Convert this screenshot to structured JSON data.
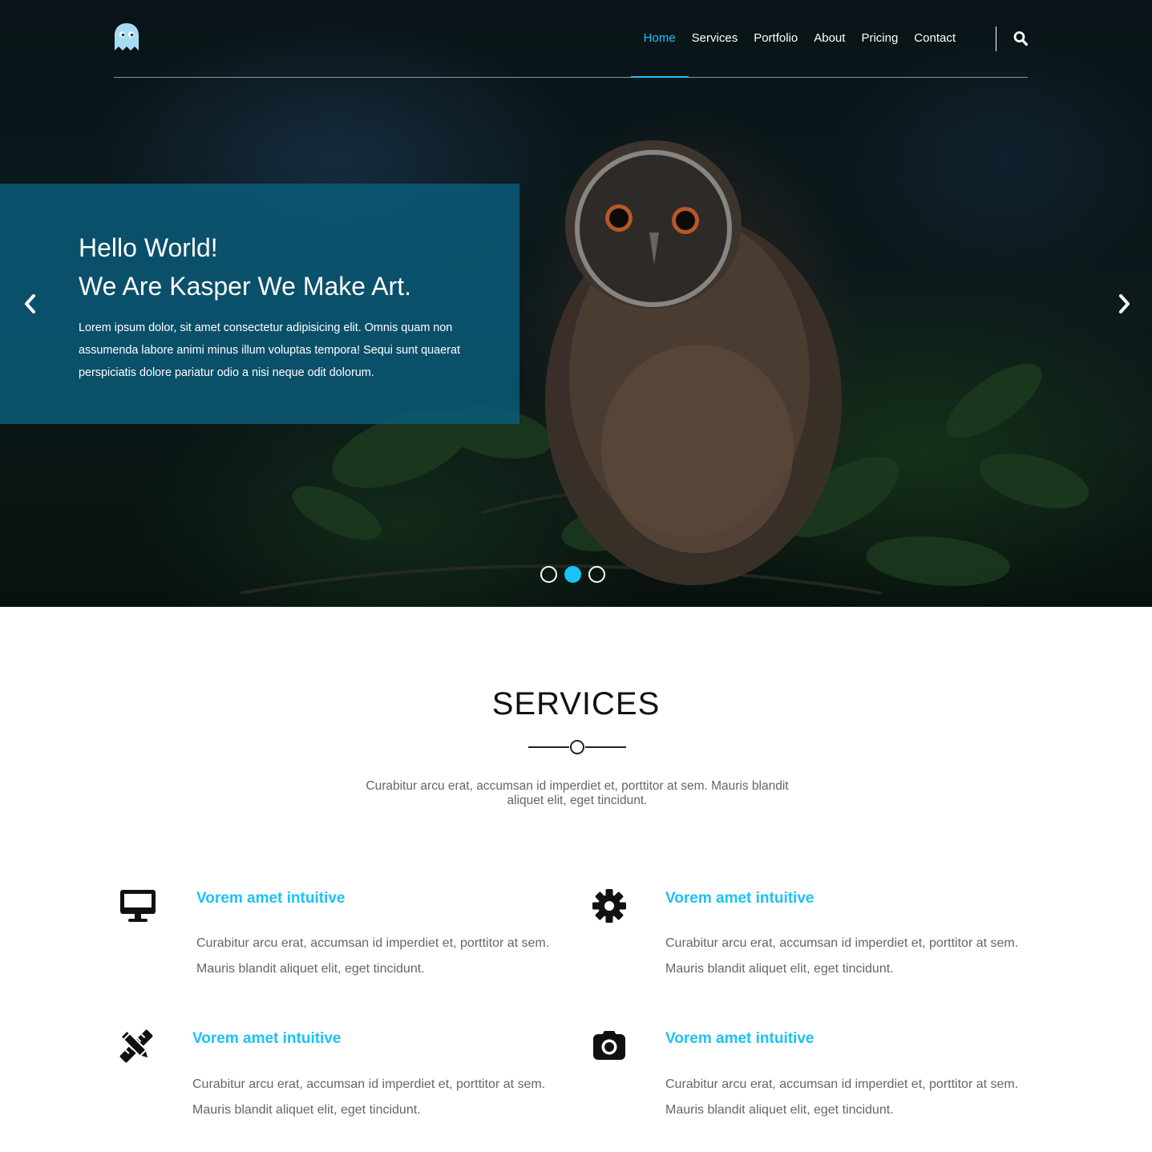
{
  "brand": {
    "logo": "ghost-logo",
    "accent_color": "#19c2fa"
  },
  "nav": {
    "items": [
      {
        "label": "Home",
        "active": true
      },
      {
        "label": "Services",
        "active": false
      },
      {
        "label": "Portfolio",
        "active": false
      },
      {
        "label": "About",
        "active": false
      },
      {
        "label": "Pricing",
        "active": false
      },
      {
        "label": "Contact",
        "active": false
      }
    ],
    "search_icon": "search-icon"
  },
  "hero": {
    "title_line1": "Hello World!",
    "title_line2": "We Are Kasper We Make Art.",
    "text": "Lorem ipsum dolor, sit amet consectetur adipisicing elit. Omnis quam non assumenda labore animi minus illum voluptas tempora! Sequi sunt quaerat perspiciatis dolore pariatur odio a nisi neque odit dolorum.",
    "prev_icon": "chevron-left-icon",
    "next_icon": "chevron-right-icon",
    "slide_count": 3,
    "active_slide": 2
  },
  "services": {
    "title": "SERVICES",
    "intro": "Curabitur arcu erat, accumsan id imperdiet et, porttitor at sem. Mauris blandit aliquet elit, eget tincidunt.",
    "items": [
      {
        "icon": "desktop-icon",
        "title": "Vorem amet intuitive",
        "text": "Curabitur arcu erat, accumsan id imperdiet et, porttitor at sem. Mauris blandit aliquet elit, eget tincidunt."
      },
      {
        "icon": "gear-icon",
        "title": "Vorem amet intuitive",
        "text": "Curabitur arcu erat, accumsan id imperdiet et, porttitor at sem. Mauris blandit aliquet elit, eget tincidunt."
      },
      {
        "icon": "pencil-ruler-icon",
        "title": "Vorem amet intuitive",
        "text": "Curabitur arcu erat, accumsan id imperdiet et, porttitor at sem. Mauris blandit aliquet elit, eget tincidunt."
      },
      {
        "icon": "camera-icon",
        "title": "Vorem amet intuitive",
        "text": "Curabitur arcu erat, accumsan id imperdiet et, porttitor at sem. Mauris blandit aliquet elit, eget tincidunt."
      }
    ]
  }
}
